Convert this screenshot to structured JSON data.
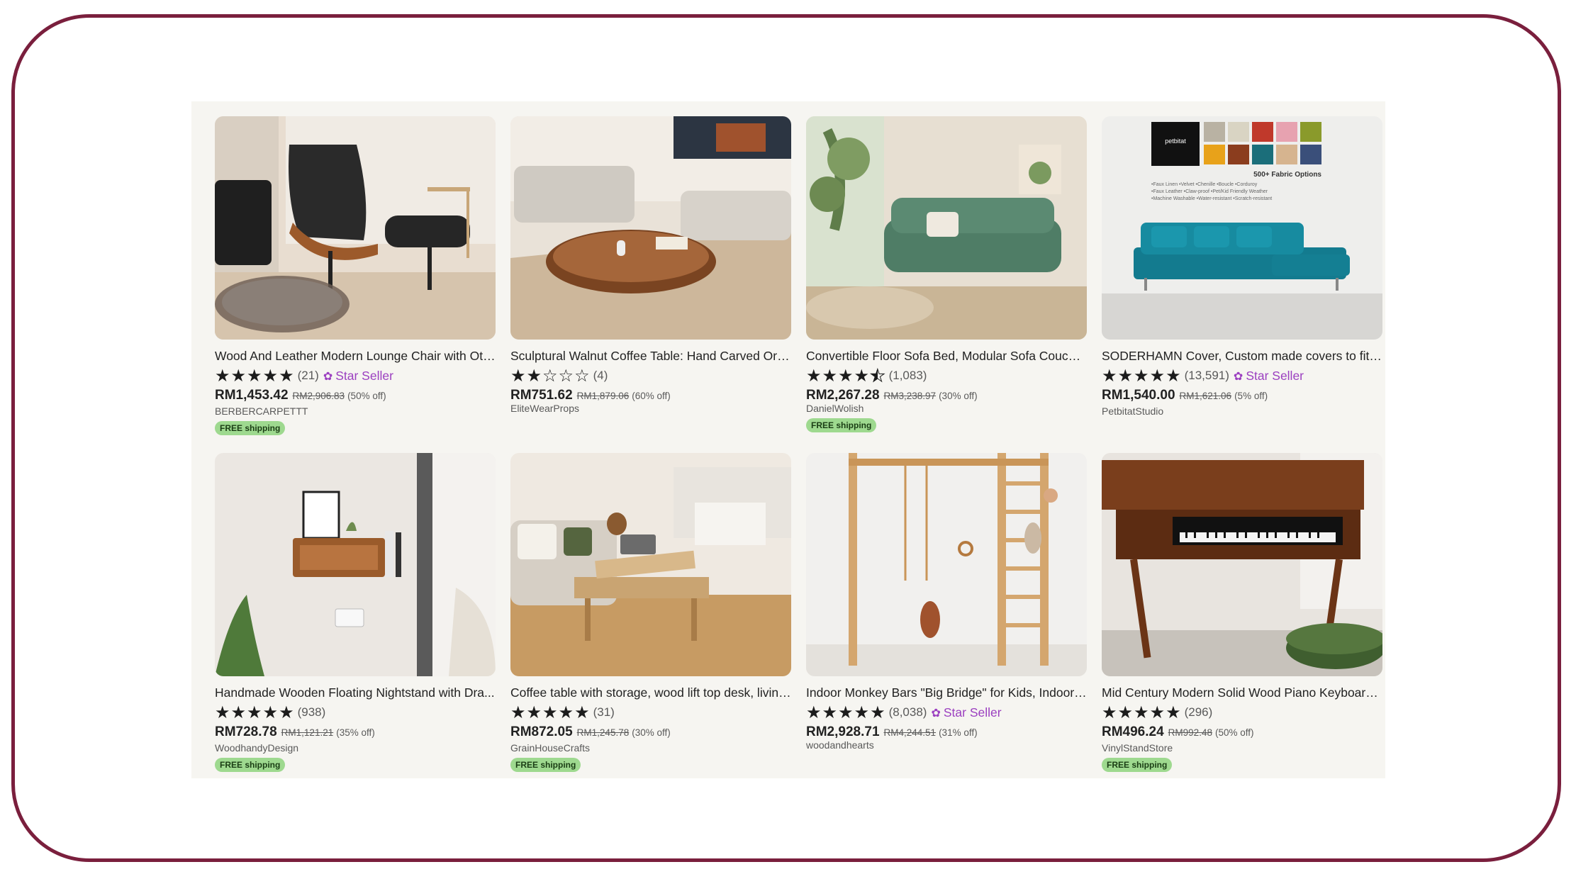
{
  "listings": [
    {
      "title": "Wood And Leather Modern Lounge Chair with Ott...",
      "stars": 5,
      "reviews": "(21)",
      "star_seller": "Star Seller",
      "price": "RM1,453.42",
      "original_price": "RM2,906.83",
      "discount": "(50% off)",
      "shop": "BERBERCARPETTT",
      "shipping": "FREE shipping"
    },
    {
      "title": "Sculptural Walnut Coffee Table: Hand Carved Org...",
      "stars": 2,
      "reviews": "(4)",
      "star_seller": "",
      "price": "RM751.62",
      "original_price": "RM1,879.06",
      "discount": "(60% off)",
      "shop": "EliteWearProps",
      "shipping": ""
    },
    {
      "title": "Convertible Floor Sofa Bed, Modular Sofa Couch, ...",
      "stars": 4.5,
      "reviews": "(1,083)",
      "star_seller": "",
      "price": "RM2,267.28",
      "original_price": "RM3,238.97",
      "discount": "(30% off)",
      "shop": "DanielWolish",
      "shipping": "FREE shipping"
    },
    {
      "title": "SODERHAMN Cover, Custom made covers to fit S...",
      "stars": 5,
      "reviews": "(13,591)",
      "star_seller": "Star Seller",
      "price": "RM1,540.00",
      "original_price": "RM1,621.06",
      "discount": "(5% off)",
      "shop": "PetbitatStudio",
      "shipping": "",
      "image_text": {
        "brand": "petbitat",
        "headline": "500+ Fabric Options",
        "lines": [
          "•Faux Linen  •Velvet  •Chenille  •Boucle  •Corduroy",
          "•Faux Leather  •Claw-proof  •Pet/Kid Friendly Weather",
          "•Machine Washable  •Water-resistant  •Scratch-resistant"
        ]
      }
    },
    {
      "title": "Handmade Wooden Floating Nightstand with Dra...",
      "stars": 5,
      "reviews": "(938)",
      "star_seller": "",
      "price": "RM728.78",
      "original_price": "RM1,121.21",
      "discount": "(35% off)",
      "shop": "WoodhandyDesign",
      "shipping": "FREE shipping"
    },
    {
      "title": "Coffee table with storage, wood lift top desk, living...",
      "stars": 5,
      "reviews": "(31)",
      "star_seller": "",
      "price": "RM872.05",
      "original_price": "RM1,245.78",
      "discount": "(30% off)",
      "shop": "GrainHouseCrafts",
      "shipping": "FREE shipping"
    },
    {
      "title": "Indoor Monkey Bars \"Big Bridge\" for Kids, Indoor C...",
      "stars": 5,
      "reviews": "(8,038)",
      "star_seller": "Star Seller",
      "price": "RM2,928.71",
      "original_price": "RM4,244.51",
      "discount": "(31% off)",
      "shop": "woodandhearts",
      "shipping": ""
    },
    {
      "title": "Mid Century Modern Solid Wood Piano Keyboard ...",
      "stars": 5,
      "reviews": "(296)",
      "star_seller": "",
      "price": "RM496.24",
      "original_price": "RM992.48",
      "discount": "(50% off)",
      "shop": "VinylStandStore",
      "shipping": "FREE shipping"
    }
  ],
  "colors": {
    "frame_border": "#7a1f3d",
    "panel_bg": "#f6f5f1",
    "star_seller": "#9b3fc0",
    "free_shipping_bg": "#9ed98f"
  },
  "icons": {
    "star_seller_badge": "badge-icon",
    "rating_star": "star-icon"
  }
}
